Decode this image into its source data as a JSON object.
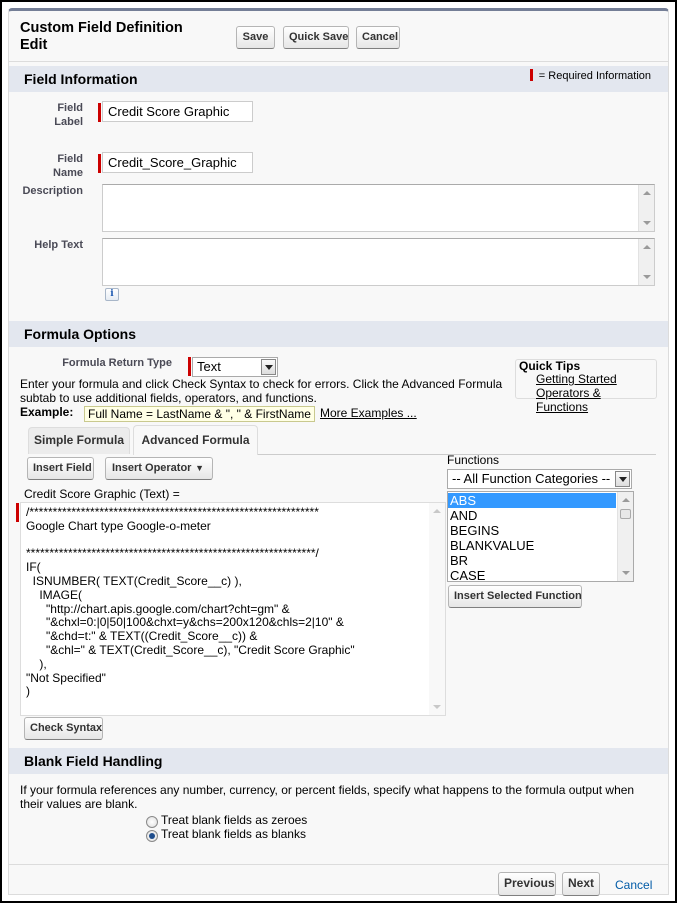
{
  "header": {
    "title": "Custom Field Definition Edit",
    "buttons": {
      "save": "Save",
      "quick_save": "Quick Save",
      "cancel": "Cancel"
    }
  },
  "field_information": {
    "title": "Field Information",
    "required_legend": "= Required Information",
    "field_label": {
      "label": "Field Label",
      "value": "Credit Score Graphic"
    },
    "field_name": {
      "label": "Field Name",
      "value": "Credit_Score_Graphic"
    },
    "description": {
      "label": "Description",
      "value": ""
    },
    "help_text": {
      "label": "Help Text",
      "value": "",
      "info_icon": "i"
    }
  },
  "formula_options": {
    "title": "Formula Options",
    "return_type": {
      "label": "Formula Return Type",
      "value": "Text"
    },
    "instructions": "Enter your formula and click Check Syntax to check for errors. Click the Advanced Formula subtab to use additional fields, operators, and functions.",
    "example_label": "Example:",
    "example_value": "Full Name = LastName & \", \" & FirstName",
    "more_examples": "More Examples ...",
    "quick_tips": {
      "title": "Quick Tips",
      "links": [
        "Getting Started",
        "Operators & Functions"
      ]
    },
    "tabs": [
      {
        "label": "Simple Formula",
        "active": false
      },
      {
        "label": "Advanced Formula",
        "active": true
      }
    ],
    "insert_field": "Insert Field",
    "insert_operator": "Insert Operator",
    "formula_header": "Credit Score Graphic (Text) =",
    "formula_text": "/**************************************************************\nGoogle Chart type Google-o-meter\n\n**************************************************************/\nIF(\n  ISNUMBER( TEXT(Credit_Score__c) ),\n    IMAGE(\n      \"http://chart.apis.google.com/chart?cht=gm\" &\n      \"&chxl=0:|0|50|100&chxt=y&chs=200x120&chls=2|10\" &\n      \"&chd=t:\" & TEXT((Credit_Score__c)) &\n      \"&chl=\" & TEXT(Credit_Score__c), \"Credit Score Graphic\"\n    ),\n\"Not Specified\"\n)",
    "functions": {
      "label": "Functions",
      "category": "-- All Function Categories --",
      "items": [
        "ABS",
        "AND",
        "BEGINS",
        "BLANKVALUE",
        "BR",
        "CASE"
      ],
      "selected": "ABS",
      "insert_button": "Insert Selected Function"
    },
    "check_syntax": "Check Syntax"
  },
  "blank_field_handling": {
    "title": "Blank Field Handling",
    "description": "If your formula references any number, currency, or percent fields, specify what happens to the formula output when their values are blank.",
    "options": [
      {
        "label": "Treat blank fields as zeroes",
        "selected": false
      },
      {
        "label": "Treat blank fields as blanks",
        "selected": true
      }
    ]
  },
  "footer": {
    "previous": "Previous",
    "next": "Next",
    "cancel": "Cancel"
  },
  "colors": {
    "required": "#cc0000",
    "section_header": "#e3e7ef",
    "selected_item": "#3399ff",
    "link_blue": "#015ba7"
  }
}
